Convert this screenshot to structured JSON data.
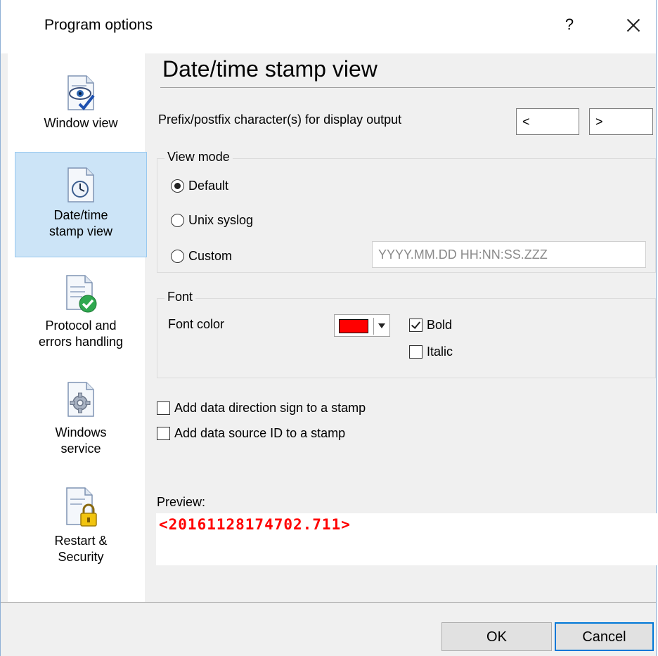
{
  "window": {
    "title": "Program options",
    "help_label": "?"
  },
  "sidebar": {
    "items": [
      {
        "label_lines": [
          "Window view"
        ],
        "icon": "eye-check-icon",
        "selected": false
      },
      {
        "label_lines": [
          "Date/time",
          "stamp view"
        ],
        "icon": "clock-icon",
        "selected": true
      },
      {
        "label_lines": [
          "Protocol and",
          "errors handling"
        ],
        "icon": "green-check-icon",
        "selected": false
      },
      {
        "label_lines": [
          "Windows",
          "service"
        ],
        "icon": "gear-icon",
        "selected": false
      },
      {
        "label_lines": [
          "Restart &",
          "Security"
        ],
        "icon": "lock-icon",
        "selected": false
      }
    ]
  },
  "main": {
    "title": "Date/time stamp view",
    "prefix_label": "Prefix/postfix character(s) for display output",
    "prefix_value": "<",
    "postfix_value": ">",
    "view_mode": {
      "legend": "View mode",
      "options": [
        "Default",
        "Unix syslog",
        "Custom"
      ],
      "selected": "Default",
      "custom_format": "YYYY.MM.DD HH:NN:SS.ZZZ"
    },
    "font": {
      "legend": "Font",
      "color_label": "Font color",
      "color_value": "#ff0000",
      "bold_label": "Bold",
      "bold_checked": true,
      "italic_label": "Italic",
      "italic_checked": false
    },
    "add_direction_label": "Add data direction sign to a stamp",
    "add_source_label": "Add data source ID to a stamp",
    "preview_label": "Preview:",
    "preview_value": "<20161128174702.711>",
    "preview_color": "#ff0000"
  },
  "footer": {
    "ok_label": "OK",
    "cancel_label": "Cancel"
  }
}
